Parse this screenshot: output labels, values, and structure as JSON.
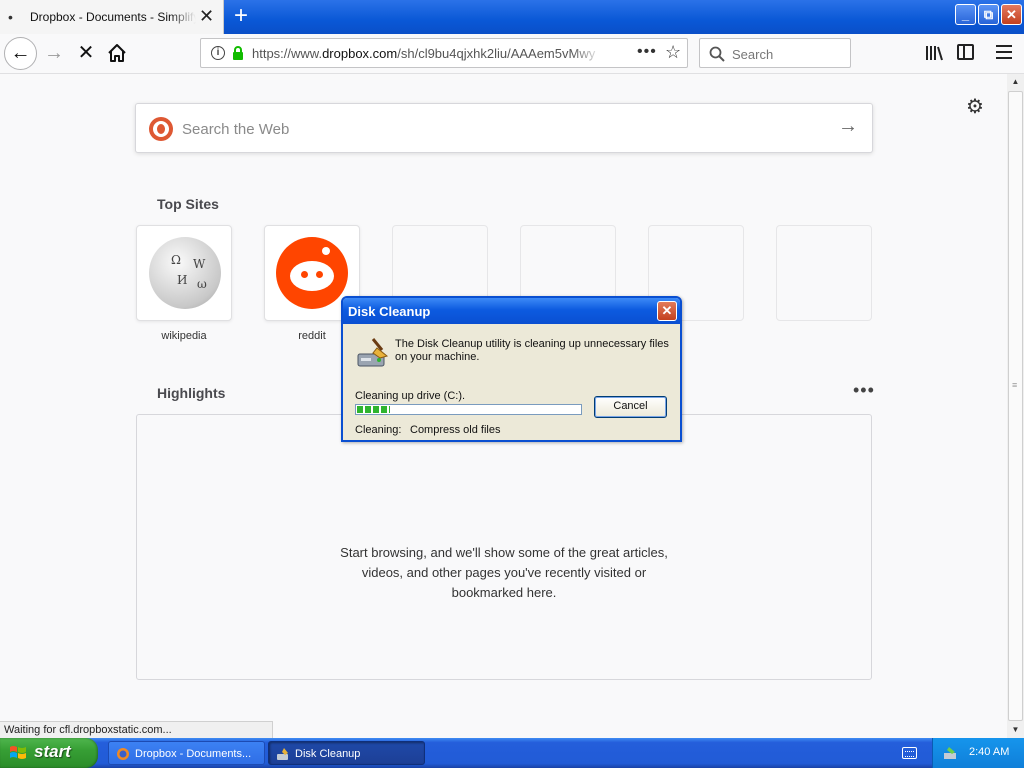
{
  "browser": {
    "tab": {
      "title": "Dropbox - Documents - Simplify your life",
      "close_glyph": "✕"
    },
    "new_tab_glyph": "+",
    "window_controls": {
      "minimize": "_",
      "maximize": "⧉",
      "close": "✕"
    },
    "nav": {
      "back_glyph": "←",
      "forward_glyph": "→",
      "stop_glyph": "✕"
    },
    "url": {
      "prefix": "https://www.",
      "domain": "dropbox.com",
      "path": "/sh/cl9bu4qjxhk2liu/AAAem5vMwy",
      "info_glyph": "i",
      "more_glyph": "•••",
      "star_glyph": "☆"
    },
    "search": {
      "placeholder": "Search"
    },
    "status_text": "Waiting for cfl.dropboxstatic.com..."
  },
  "newtab": {
    "settings_glyph": "⚙",
    "web_search": {
      "placeholder": "Search the Web",
      "go_glyph": "→"
    },
    "top_sites": {
      "title": "Top Sites",
      "sites": [
        {
          "label": "wikipedia"
        },
        {
          "label": "reddit"
        }
      ]
    },
    "highlights": {
      "title": "Highlights",
      "more_glyph": "•••",
      "empty_message": "Start browsing, and we'll show some of the great articles,\nvideos, and other pages you've recently visited or\nbookmarked here."
    }
  },
  "dialog": {
    "title": "Disk Cleanup",
    "close_glyph": "✕",
    "message": "The Disk Cleanup utility is cleaning up unnecessary files on your machine.",
    "drive_label": "Cleaning up drive  (C:).",
    "progress": 0.15,
    "cancel_label": "Cancel",
    "cleaning_label": "Cleaning:",
    "cleaning_value": "Compress old files"
  },
  "taskbar": {
    "start_label": "start",
    "tasks": [
      {
        "label": "Dropbox - Documents...",
        "active": false
      },
      {
        "label": "Disk Cleanup",
        "active": true
      }
    ],
    "clock": "2:40 AM"
  },
  "colors": {
    "xp_blue": "#245edb",
    "start_green": "#379f35",
    "progress_green": "#2fb42f",
    "duckduckgo": "#de5833",
    "reddit": "#ff4500"
  },
  "icons": {
    "tab": "page-dot-icon",
    "home": "home-icon",
    "lock": "lock-icon",
    "library": "library-icon",
    "sidebar": "sidebar-icon",
    "menu": "hamburger-menu-icon",
    "disk_cleanup": "disk-cleanup-icon",
    "windows_flag": "windows-flag-icon"
  }
}
